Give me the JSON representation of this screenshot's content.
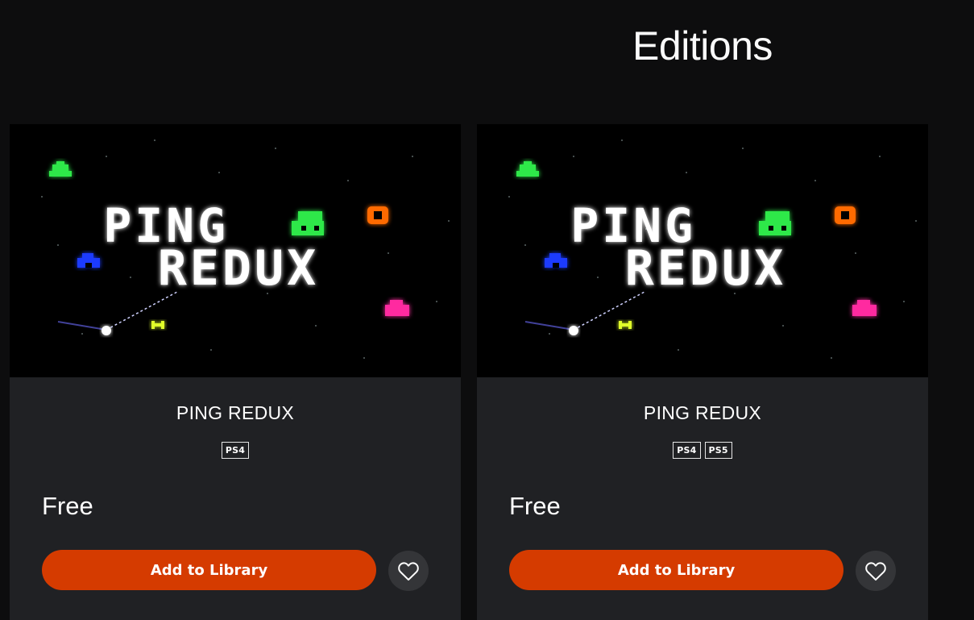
{
  "section": {
    "title": "Editions"
  },
  "editions": [
    {
      "title": "PING REDUX",
      "art_title_lines": [
        "PING",
        "REDUX"
      ],
      "platforms": [
        "PS4"
      ],
      "price": "Free",
      "cta": "Add to Library",
      "wishlist_icon": "heart-outline-icon"
    },
    {
      "title": "PING REDUX",
      "art_title_lines": [
        "PING",
        "REDUX"
      ],
      "platforms": [
        "PS4",
        "PS5"
      ],
      "price": "Free",
      "cta": "Add to Library",
      "wishlist_icon": "heart-outline-icon"
    }
  ],
  "colors": {
    "page_bg": "#0d0d0e",
    "card_bg": "#202124",
    "accent": "#d53b00",
    "wishlist_bg": "#343538"
  }
}
